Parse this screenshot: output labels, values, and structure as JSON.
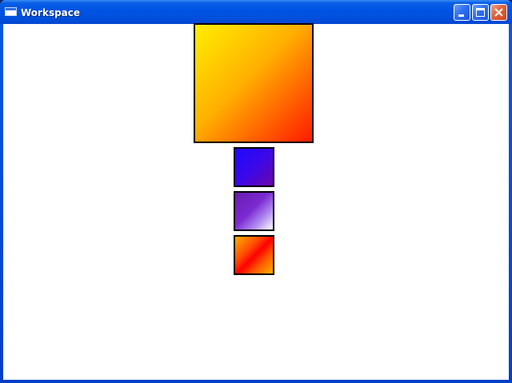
{
  "window": {
    "title": "Workspace",
    "icon": "window-icon",
    "controls": {
      "minimize_icon": "minimize-icon",
      "maximize_icon": "maximize-icon",
      "close_icon": "close-icon"
    }
  },
  "workspace": {
    "background": "#ffffff",
    "squares": [
      {
        "name": "large-gradient-square",
        "colors": [
          "#ffee00",
          "#ffb000",
          "#ff1a00"
        ]
      },
      {
        "name": "blue-gradient-square",
        "colors": [
          "#1e0aff",
          "#3a08e8",
          "#6a08a8"
        ]
      },
      {
        "name": "purple-gradient-square",
        "colors": [
          "#6a1ab0",
          "#b08af0",
          "#ffffff"
        ]
      },
      {
        "name": "red-gradient-square",
        "colors": [
          "#ffb000",
          "#ff0000",
          "#ffb000"
        ]
      }
    ]
  }
}
